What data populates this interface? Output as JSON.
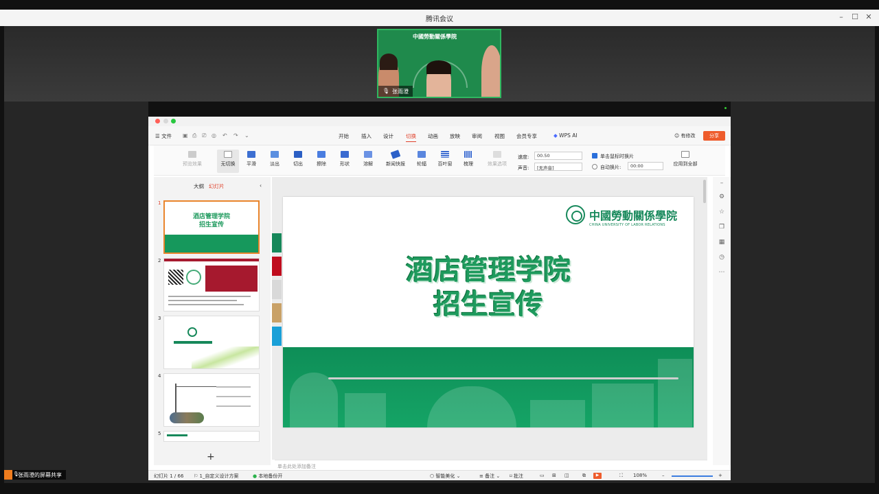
{
  "meeting": {
    "title": "腾讯会议",
    "share_status": "张雨澄的屏幕共享",
    "video_label": "张雨澄",
    "video_logo": "中國勞動關係學院"
  },
  "wps": {
    "file_menu": "文件",
    "tabs": [
      "开始",
      "插入",
      "设计",
      "切换",
      "动画",
      "放映",
      "审阅",
      "视图",
      "会员专享",
      "WPS AI"
    ],
    "active_tab": "切换",
    "modify_label": "有修改",
    "share_label": "分享",
    "ribbon": {
      "preview": "预览效果",
      "transitions": [
        "无切换",
        "平滑",
        "淡出",
        "切出",
        "擦除",
        "形状",
        "溶解",
        "新闻快报",
        "轮辐",
        "百叶窗",
        "梳理"
      ],
      "effect_options": "效果选项",
      "speed_label": "速度:",
      "speed_value": "00.50",
      "sound_label": "声音:",
      "sound_value": "[无声音]",
      "click_switch": "单击鼠标时换片",
      "auto_switch": "自动换片:",
      "auto_value": "00:00",
      "apply_all": "应用到全部"
    },
    "panel": {
      "tab_outline": "大纲",
      "tab_slides": "幻灯片",
      "slide_numbers": [
        "1",
        "2",
        "3",
        "4",
        "5"
      ]
    },
    "slide": {
      "logo_cn": "中國勞動關係學院",
      "logo_en": "CHINA UNIVERSITY OF LABOR RELATIONS",
      "title_line1": "酒店管理学院",
      "title_line2": "招生宣传"
    },
    "thumb1": {
      "line1": "酒店管理学院",
      "line2": "招生宣传"
    },
    "notes_placeholder": "单击此处添加备注",
    "status": {
      "slide_count": "幻灯片 1 / 66",
      "theme": "1_自定义设计方案",
      "backup": "本地备份开",
      "beautify": "智能美化",
      "notes": "备注",
      "comments": "批注",
      "zoom": "108%"
    }
  },
  "colors": {
    "accent_green": "#16885a",
    "wps_red": "#e0402a",
    "share_orange": "#ee5c2c"
  }
}
